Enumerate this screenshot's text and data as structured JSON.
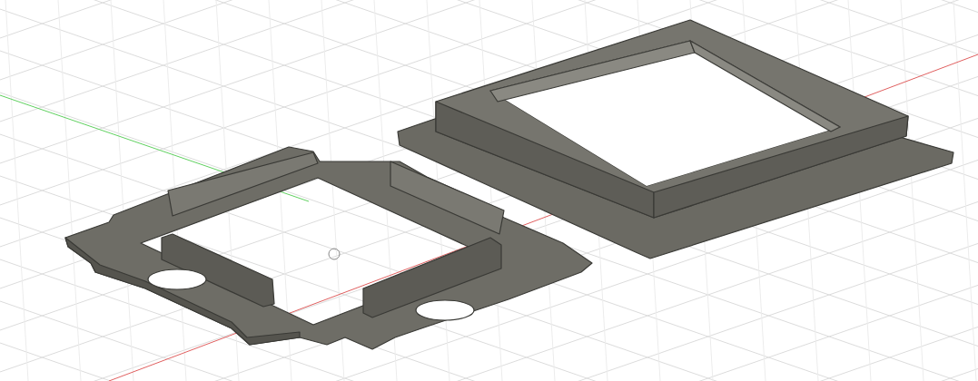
{
  "viewport": {
    "axes": [
      {
        "kind": "x",
        "color": "#e06060"
      },
      {
        "kind": "y",
        "color": "#60d060"
      }
    ]
  }
}
